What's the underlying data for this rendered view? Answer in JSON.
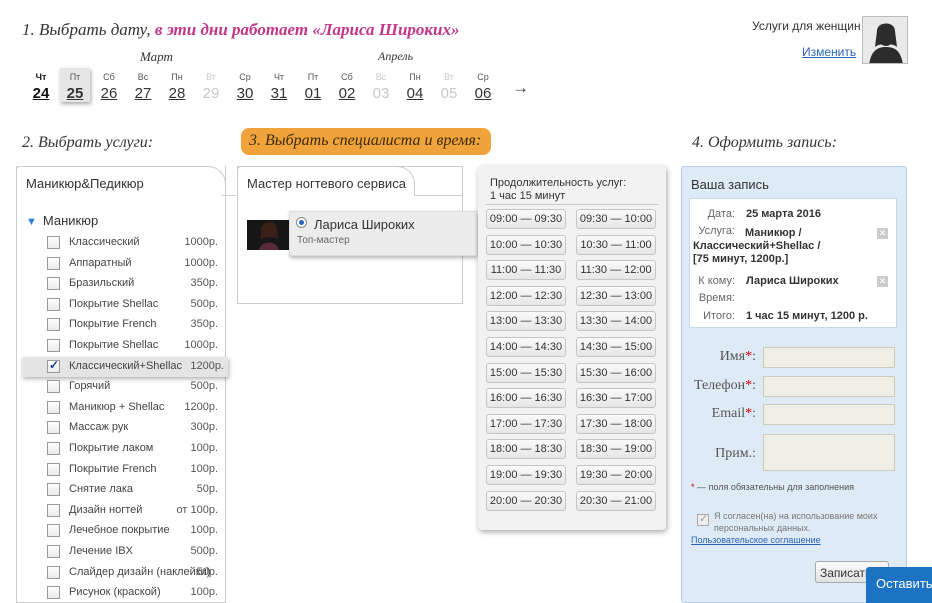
{
  "header": {
    "step1_prefix": "1. Выбрать дату,",
    "step1_highlight": "в эти дни работает «Лариса Широких»",
    "service_label": "Услуги для женщин",
    "change_link": "Изменить"
  },
  "calendar": {
    "months": [
      "Март",
      "Апрель"
    ],
    "days": [
      {
        "dw": "Чт",
        "dn": "24",
        "state": "today"
      },
      {
        "dw": "Пт",
        "dn": "25",
        "state": "selected"
      },
      {
        "dw": "Сб",
        "dn": "26",
        "state": "available"
      },
      {
        "dw": "Вс",
        "dn": "27",
        "state": "available"
      },
      {
        "dw": "Пн",
        "dn": "28",
        "state": "available"
      },
      {
        "dw": "Вт",
        "dn": "29",
        "state": "disabled"
      },
      {
        "dw": "Ср",
        "dn": "30",
        "state": "available"
      },
      {
        "dw": "Чт",
        "dn": "31",
        "state": "available"
      },
      {
        "dw": "Пт",
        "dn": "01",
        "state": "available"
      },
      {
        "dw": "Сб",
        "dn": "02",
        "state": "available"
      },
      {
        "dw": "Вс",
        "dn": "03",
        "state": "disabled"
      },
      {
        "dw": "Пн",
        "dn": "04",
        "state": "available"
      },
      {
        "dw": "Вт",
        "dn": "05",
        "state": "disabled"
      },
      {
        "dw": "Ср",
        "dn": "06",
        "state": "available"
      }
    ],
    "next_arrow": "→"
  },
  "steps": {
    "step2": "2. Выбрать услуги:",
    "step3": "3. Выбрать специалиста и время:",
    "step4": "4. Оформить запись:"
  },
  "services": {
    "tab": "Маникюр&Педикюр",
    "category": "Маникюр",
    "items": [
      {
        "name": "Классический",
        "price": "1000р.",
        "checked": false
      },
      {
        "name": "Аппаратный",
        "price": "1000р.",
        "checked": false
      },
      {
        "name": "Бразильский",
        "price": "350р.",
        "checked": false
      },
      {
        "name": "Покрытие Shellac",
        "price": "500р.",
        "checked": false
      },
      {
        "name": "Покрытие French",
        "price": "350р.",
        "checked": false
      },
      {
        "name": "Покрытие Shellac",
        "price": "1000р.",
        "checked": false
      },
      {
        "name": "Классический+Shellac",
        "price": "1200р.",
        "checked": true
      },
      {
        "name": "Горячий",
        "price": "500р.",
        "checked": false
      },
      {
        "name": "Маникюр + Shellac",
        "price": "1200р.",
        "checked": false
      },
      {
        "name": "Массаж рук",
        "price": "300р.",
        "checked": false
      },
      {
        "name": "Покрытие лаком",
        "price": "100р.",
        "checked": false
      },
      {
        "name": "Покрытие French",
        "price": "100р.",
        "checked": false
      },
      {
        "name": "Снятие лака",
        "price": "50р.",
        "checked": false
      },
      {
        "name": "Дизайн ногтей",
        "price": "от 100р.",
        "checked": false
      },
      {
        "name": "Лечебное покрытие",
        "price": "100р.",
        "checked": false
      },
      {
        "name": "Лечение IBX",
        "price": "500р.",
        "checked": false
      },
      {
        "name": "Слайдер дизайн (наклейки)",
        "price": "50р.",
        "checked": false
      },
      {
        "name": "Рисунок (краской)",
        "price": "100р.",
        "checked": false
      }
    ]
  },
  "master": {
    "tab": "Мастер ногтевого сервиса",
    "name": "Лариса Широких",
    "role": "Топ-мастер"
  },
  "times": {
    "duration_label": "Продолжительность услуг:",
    "duration_value": "1 час 15 минут",
    "slots": [
      "09:00 — 09:30",
      "09:30 — 10:00",
      "10:00 — 10:30",
      "10:30 — 11:00",
      "11:00 — 11:30",
      "11:30 — 12:00",
      "12:00 — 12:30",
      "12:30 — 13:00",
      "13:00 — 13:30",
      "13:30 — 14:00",
      "14:00 — 14:30",
      "14:30 — 15:00",
      "15:00 — 15:30",
      "15:30 — 16:00",
      "16:00 — 16:30",
      "16:30 — 17:00",
      "17:00 — 17:30",
      "17:30 — 18:00",
      "18:00 — 18:30",
      "18:30 — 19:00",
      "19:00 — 19:30",
      "19:30 — 20:00",
      "20:00 — 20:30",
      "20:30 — 21:00"
    ]
  },
  "booking": {
    "title": "Ваша запись",
    "date_label": "Дата:",
    "date_value": "25 марта 2016",
    "service_label": "Услуга:",
    "service_value_1": "Маникюр /",
    "service_value_2": "Классический+Shellac /",
    "service_value_3": "[75 минут, 1200р.]",
    "to_label": "К кому:",
    "to_value": "Лариса Широких",
    "time_label": "Время:",
    "total_label": "Итого:",
    "total_value": "1 час 15 минут, 1200 р.",
    "remove_icon": "✕",
    "fields": {
      "name": "Имя",
      "phone": "Телефон",
      "email": "Email",
      "note": "Прим.:"
    },
    "required_star": "*",
    "required_note": "— поля обязательны для заполнения",
    "agree_text": "Я согласен(на) на использование моих персональных данных.",
    "agree_link": "Пользовательское соглашение",
    "submit": "Записаться",
    "leave": "Оставить"
  },
  "colors": {
    "accent_pink": "#c2368a",
    "step3_orange": "#f0a33a",
    "link_blue": "#2a64b8",
    "booking_bg": "#deeaf6",
    "leave_blue": "#1c73c4"
  }
}
